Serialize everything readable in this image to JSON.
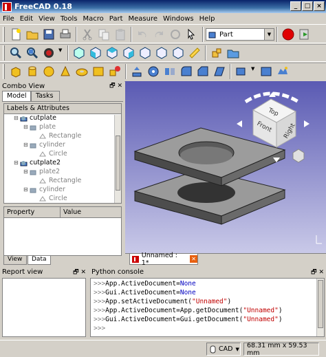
{
  "window": {
    "title": "FreeCAD 0.18"
  },
  "menu": [
    "File",
    "Edit",
    "View",
    "Tools",
    "Macro",
    "Part",
    "Measure",
    "Windows",
    "Help"
  ],
  "toolbar": {
    "workbench": "Part"
  },
  "combo_view": {
    "title": "Combo View",
    "tabs": [
      "Model",
      "Tasks"
    ],
    "tree_header": "Labels & Attributes",
    "tree": [
      {
        "label": "cutplate",
        "level": 0,
        "visible": true
      },
      {
        "label": "plate",
        "level": 1,
        "visible": false
      },
      {
        "label": "Rectangle",
        "level": 2,
        "visible": false
      },
      {
        "label": "cylinder",
        "level": 1,
        "visible": false
      },
      {
        "label": "Circle",
        "level": 2,
        "visible": false
      },
      {
        "label": "cutplate2",
        "level": 0,
        "visible": true
      },
      {
        "label": "plate2",
        "level": 1,
        "visible": false
      },
      {
        "label": "Rectangle",
        "level": 2,
        "visible": false
      },
      {
        "label": "cylinder",
        "level": 1,
        "visible": false
      },
      {
        "label": "Circle",
        "level": 2,
        "visible": false
      }
    ],
    "prop_headers": [
      "Property",
      "Value"
    ],
    "bottom_tabs": [
      "View",
      "Data"
    ]
  },
  "view3d": {
    "cube_faces": {
      "top": "Top",
      "front": "Front",
      "right": "Right"
    },
    "doc_tab": "Unnamed : 1*"
  },
  "report_view": {
    "title": "Report view"
  },
  "python_console": {
    "title": "Python console",
    "prompt": ">>>",
    "lines": [
      {
        "code": "App.ActiveDocument=",
        "kw": "None",
        "str": ""
      },
      {
        "code": "Gui.ActiveDocument=",
        "kw": "None",
        "str": ""
      },
      {
        "code": "App.setActiveDocument(",
        "kw": "",
        "str": "\"Unnamed\"",
        "tail": ")"
      },
      {
        "code": "App.ActiveDocument=App.getDocument(",
        "kw": "",
        "str": "\"Unnamed\"",
        "tail": ")"
      },
      {
        "code": "Gui.ActiveDocument=Gui.getDocument(",
        "kw": "",
        "str": "\"Unnamed\"",
        "tail": ")"
      },
      {
        "code": "",
        "kw": "",
        "str": ""
      }
    ]
  },
  "status": {
    "nav_style": "CAD",
    "dimensions": "68.31 mm x 59.53 mm"
  },
  "colors": {
    "title_bar": "#0a246a",
    "view_top": "#5a5ab3",
    "view_bottom": "#c9c9e8",
    "record_button": "#e00000"
  }
}
